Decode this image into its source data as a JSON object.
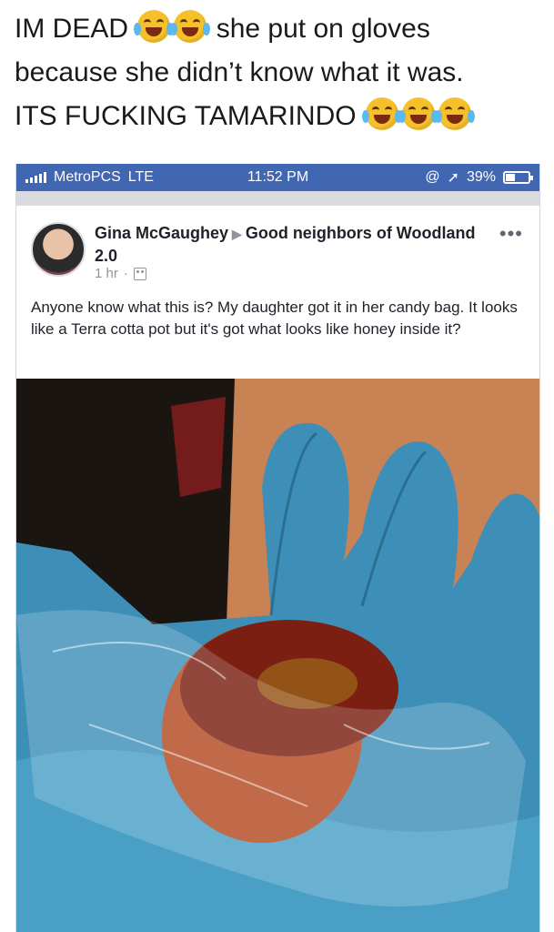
{
  "tweet": {
    "line1_a": "IM DEAD",
    "line1_b": "she put on gloves",
    "line2": "because she didn’t know what it was.",
    "line3": "ITS FUCKING TAMARINDO"
  },
  "status_bar": {
    "carrier": "MetroPCS",
    "network": "LTE",
    "time": "11:52 PM",
    "battery": "39%",
    "battery_level": 0.39
  },
  "post": {
    "author": "Gina McGaughey",
    "group": "Good neighbors of Woodland 2.0",
    "time": "1 hr",
    "more": "•••",
    "body": "Anyone know what this is? My daughter got it in her candy bag. It looks like a Terra cotta pot but it's got what looks like honey inside it?"
  },
  "icons": {
    "emoji": "face-with-tears-of-joy",
    "post_audience": "group-icon",
    "alarm": "alarm-icon",
    "location": "location-arrow-icon"
  },
  "colors": {
    "facebook_blue": "#4267b2",
    "text": "#1d2129",
    "meta": "#90949c"
  }
}
